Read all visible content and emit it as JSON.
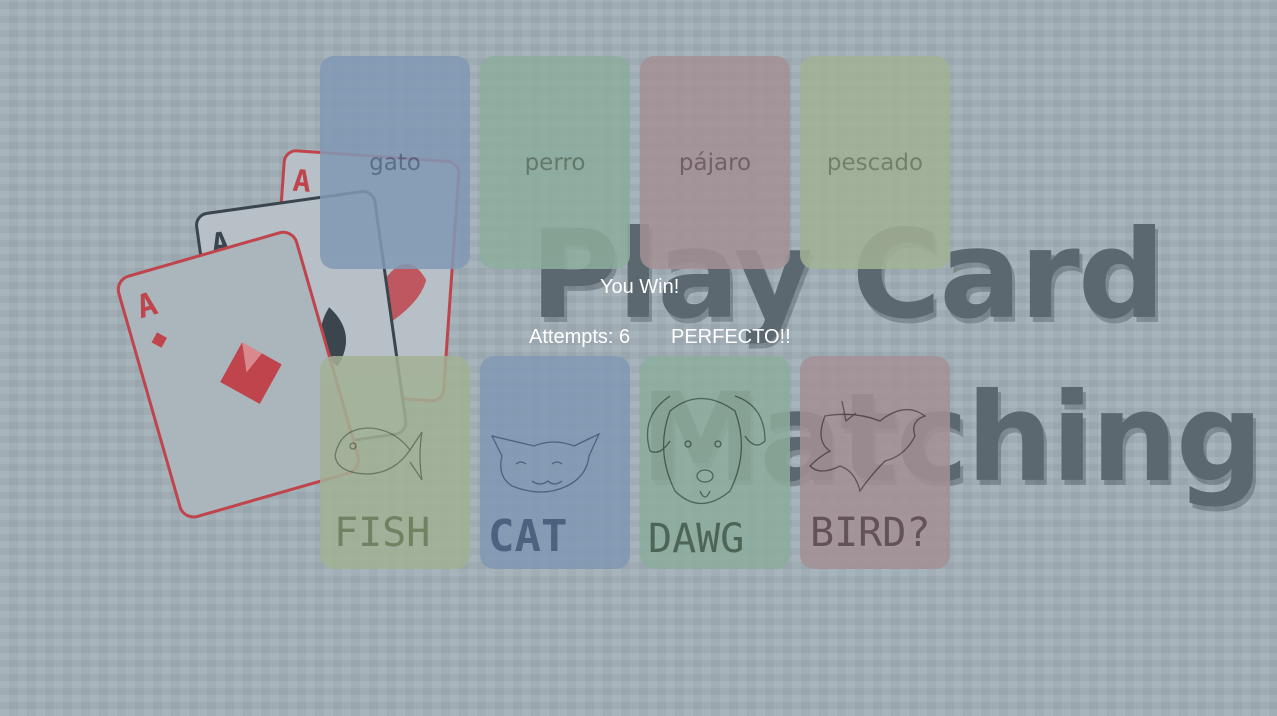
{
  "background": {
    "title_line1": "Play Card",
    "title_line2": "Matching",
    "colors": {
      "background": "#a2afb7",
      "title": "#5c6870",
      "card_red": "#c0444c",
      "card_dark": "#3a454d"
    }
  },
  "word_cards": [
    {
      "word": "gato",
      "color": "#8199b5",
      "text_color": "#4c6380"
    },
    {
      "word": "perro",
      "color": "#8cac9c",
      "text_color": "#58715f"
    },
    {
      "word": "pájaro",
      "color": "#a39095",
      "text_color": "#6a5559"
    },
    {
      "word": "pescado",
      "color": "#a2b195",
      "text_color": "#6b7a5b"
    }
  ],
  "picture_cards": [
    {
      "label": "FISH",
      "icon": "fish-drawing",
      "color": "#a2b195"
    },
    {
      "label": "CAT",
      "icon": "cat-drawing",
      "color": "#8199b5"
    },
    {
      "label": "DAWG",
      "icon": "dog-drawing",
      "color": "#8cac9c"
    },
    {
      "label": "BIRD?",
      "icon": "bird-drawing",
      "color": "#a39095"
    }
  ],
  "status": {
    "win_message": "You Win!",
    "attempts_text": "Attempts: 6",
    "rating": "PERFECTO!!"
  }
}
